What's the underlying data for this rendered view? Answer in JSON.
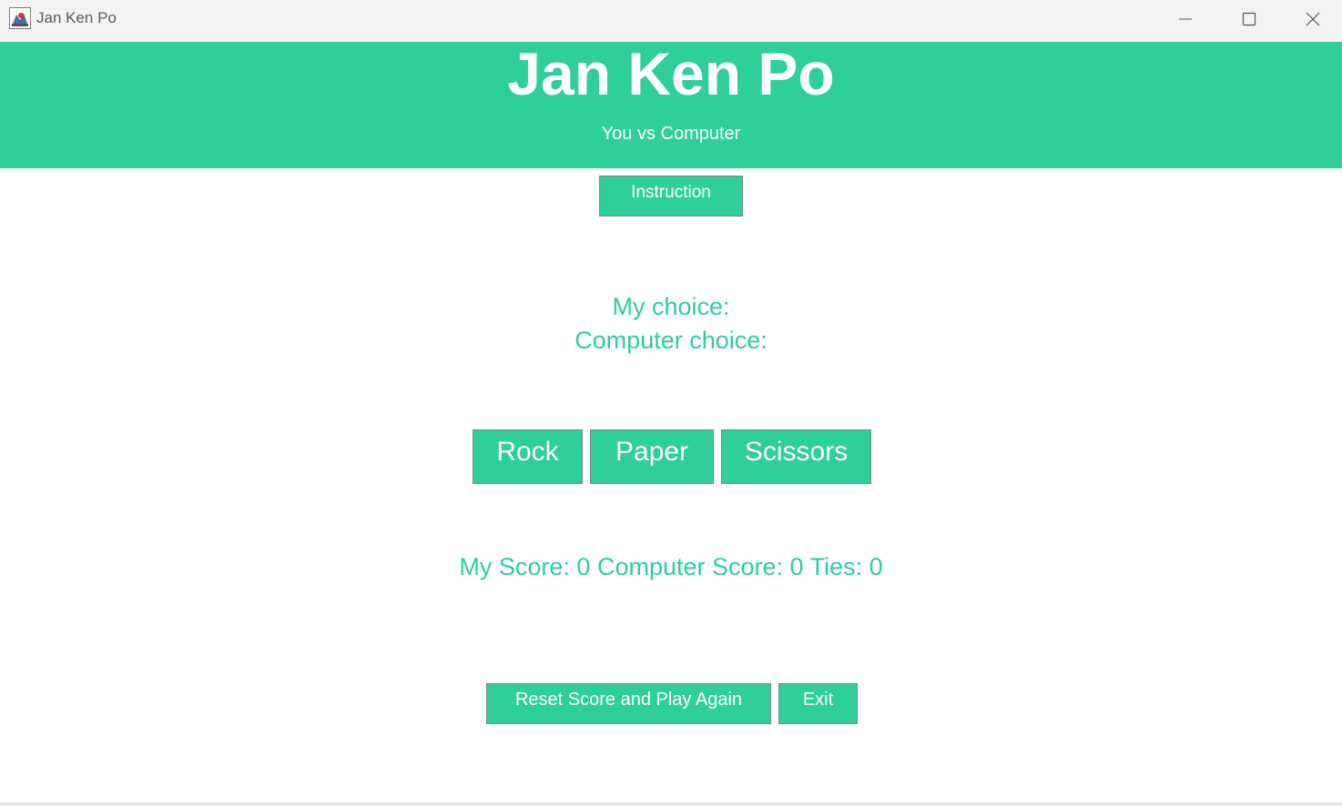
{
  "window": {
    "title": "Jan Ken Po",
    "icon": "java-app-icon",
    "controls": [
      "minimize-icon",
      "maximize-icon",
      "close-icon"
    ]
  },
  "header": {
    "title": "Jan Ken Po",
    "subtitle": "You vs Computer"
  },
  "buttons": {
    "instruction": "Instruction",
    "rock": "Rock",
    "paper": "Paper",
    "scissors": "Scissors",
    "reset": "Reset Score and Play Again",
    "exit": "Exit"
  },
  "choices": {
    "my_choice_label": "My choice:",
    "computer_choice_label": "Computer choice:"
  },
  "score": {
    "text": "My Score: 0 Computer Score: 0 Ties: 0",
    "my_score": 0,
    "computer_score": 0,
    "ties": 0
  },
  "colors": {
    "accent": "#2ecf98",
    "button_border": "#7c8b86",
    "titlebar": "#f3f3f3"
  }
}
